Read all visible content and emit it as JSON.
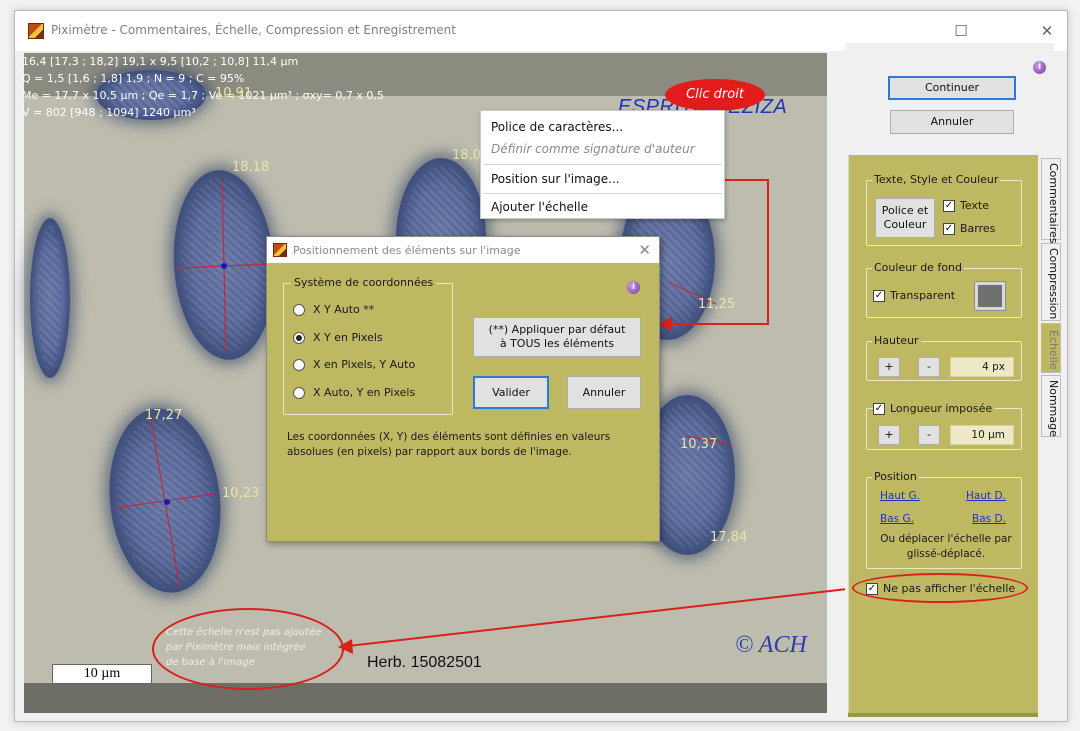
{
  "window": {
    "title": "Piximètre - Commentaires, Échelle, Compression et Enregistrement",
    "minimize": "─",
    "maximize": "☐",
    "close": "✕"
  },
  "image": {
    "stats_lines": [
      "16,4 [17,3 ; 18,2] 19,1 x 9,5 [10,2 ; 10,8] 11,4 µm",
      "Q = 1,5 [1,6 ; 1,8] 1,9 ; N = 9 ; C = 95%",
      "Me = 17,7 x 10,5 µm ; Qe = 1,7 ; Ve = 1021 µm³ ; σxy= 0,7 x 0,5",
      "V = 802 [948 ; 1094] 1240 µm³"
    ],
    "measurements": [
      "10,91",
      "18,18",
      "18,0",
      "11,25",
      "17,27",
      "10,23",
      "10,37",
      "17,84"
    ],
    "brand": "ESPRITS-PEZIZA",
    "copyright": "© ACH",
    "herbarium": "Herb. 15082501",
    "scale_label": "10 µm",
    "note_lines": [
      "Cette échelle n'est pas ajoutée",
      "par Piximètre mais intégrée",
      "de base à l'image"
    ],
    "callout": "Clic droit"
  },
  "context_menu": {
    "items": [
      {
        "label": "Police de caractères...",
        "enabled": true
      },
      {
        "label": "Définir comme signature d'auteur",
        "enabled": false
      },
      {
        "label": "Position sur l'image...",
        "enabled": true
      },
      {
        "label": "Ajouter l'échelle",
        "enabled": true
      }
    ]
  },
  "dialog": {
    "title": "Positionnement des éléments sur l'image",
    "close": "✕",
    "group_label": "Système de coordonnées",
    "options": [
      {
        "label": "X Y Auto **",
        "checked": false
      },
      {
        "label": "X Y en Pixels",
        "checked": true
      },
      {
        "label": "X en Pixels, Y Auto",
        "checked": false
      },
      {
        "label": "X Auto, Y en Pixels",
        "checked": false
      }
    ],
    "apply_all": "(**) Appliquer par défaut à TOUS les éléments",
    "validate": "Valider",
    "cancel": "Annuler",
    "description": "Les coordonnées (X, Y) des éléments sont définies en valeurs absolues (en pixels) par rapport aux bords de l'image."
  },
  "right_panel": {
    "continue": "Continuer",
    "cancel": "Annuler",
    "tabs": [
      "Commentaires",
      "Compression",
      "Échelle",
      "Nommage"
    ],
    "text_style": {
      "label": "Texte, Style et Couleur",
      "font_button": "Police et Couleur",
      "text_check": "Texte",
      "bars_check": "Barres"
    },
    "background": {
      "label": "Couleur de fond",
      "transparent": "Transparent"
    },
    "height": {
      "label": "Hauteur",
      "plus": "+",
      "minus": "-",
      "value": "4 px"
    },
    "length": {
      "label": "Longueur imposée",
      "plus": "+",
      "minus": "-",
      "value": "10 µm"
    },
    "position": {
      "label": "Position",
      "top_left": "Haut G.",
      "top_right": "Haut D.",
      "bottom_left": "Bas G.",
      "bottom_right": "Bas D.",
      "hint": "Ou déplacer l'échelle par glissé-déplacé."
    },
    "hide_scale": "Ne pas afficher l'échelle"
  },
  "colors": {
    "panel": "#bfb863",
    "annotation_red": "#d9211c",
    "link": "#2230c9"
  }
}
